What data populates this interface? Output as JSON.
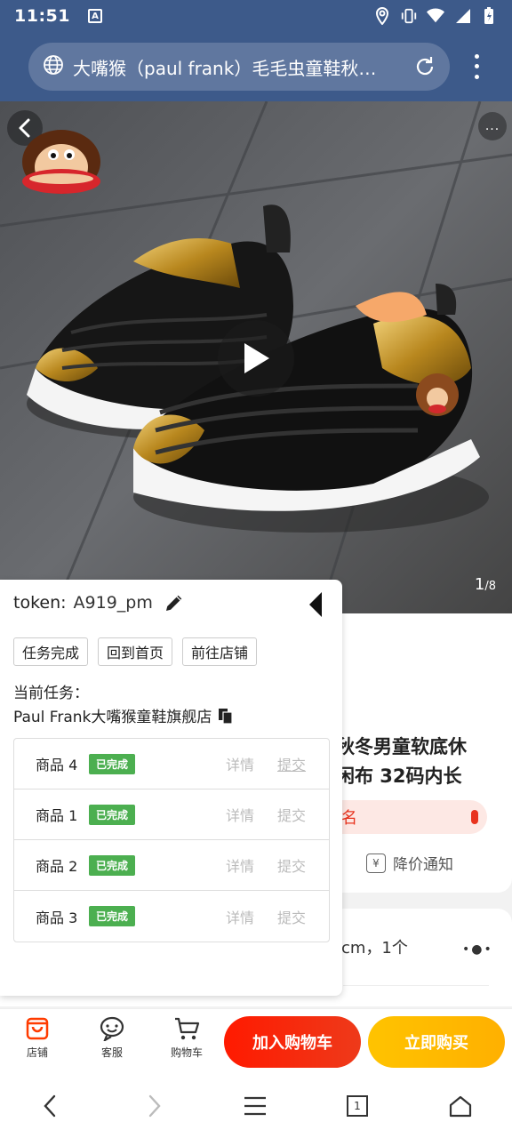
{
  "status_bar": {
    "time": "11:51",
    "notification_letter": "A"
  },
  "browser": {
    "url_title": "大嘴猴（paul frank）毛毛虫童鞋秋…"
  },
  "gallery": {
    "current": "1",
    "total": "/8",
    "more_label": "..."
  },
  "product": {
    "title_line1": "秋冬男童软底休",
    "title_line2": "闲布 32码内长",
    "rank_text": "名",
    "notify_label": "降价通知",
    "sku_text": "cm，1个",
    "sku_more": "•●•"
  },
  "panel": {
    "token_label": "token:",
    "token_value": "A919_pm",
    "buttons": [
      "任务完成",
      "回到首页",
      "前往店铺"
    ],
    "task_label": "当前任务：",
    "shop_name": "Paul Frank大嘴猴童鞋旗舰店",
    "goods": [
      {
        "name": "商品 4",
        "status": "已完成",
        "detail": "详情",
        "submit": "提交"
      },
      {
        "name": "商品 1",
        "status": "已完成",
        "detail": "详情",
        "submit": "提交"
      },
      {
        "name": "商品 2",
        "status": "已完成",
        "detail": "详情",
        "submit": "提交"
      },
      {
        "name": "商品 3",
        "status": "已完成",
        "detail": "详情",
        "submit": "提交"
      }
    ]
  },
  "action_bar": {
    "store_label": "店铺",
    "service_label": "客服",
    "cart_label": "购物车",
    "add_cart": "加入购物车",
    "buy_now": "立即购买"
  },
  "nav": {
    "tab_count": "1"
  },
  "colors": {
    "brand_red": "#ff1a00",
    "buy_yellow": "#ffc300",
    "done_green": "#4caf50",
    "header_blue": "#3d5a8a"
  },
  "icons": [
    "globe-icon",
    "reload-icon",
    "menu-icon",
    "back-icon",
    "play-icon",
    "pencil-icon",
    "collapse-icon",
    "copy-icon",
    "store-icon",
    "service-icon",
    "cart-icon",
    "home-icon"
  ]
}
